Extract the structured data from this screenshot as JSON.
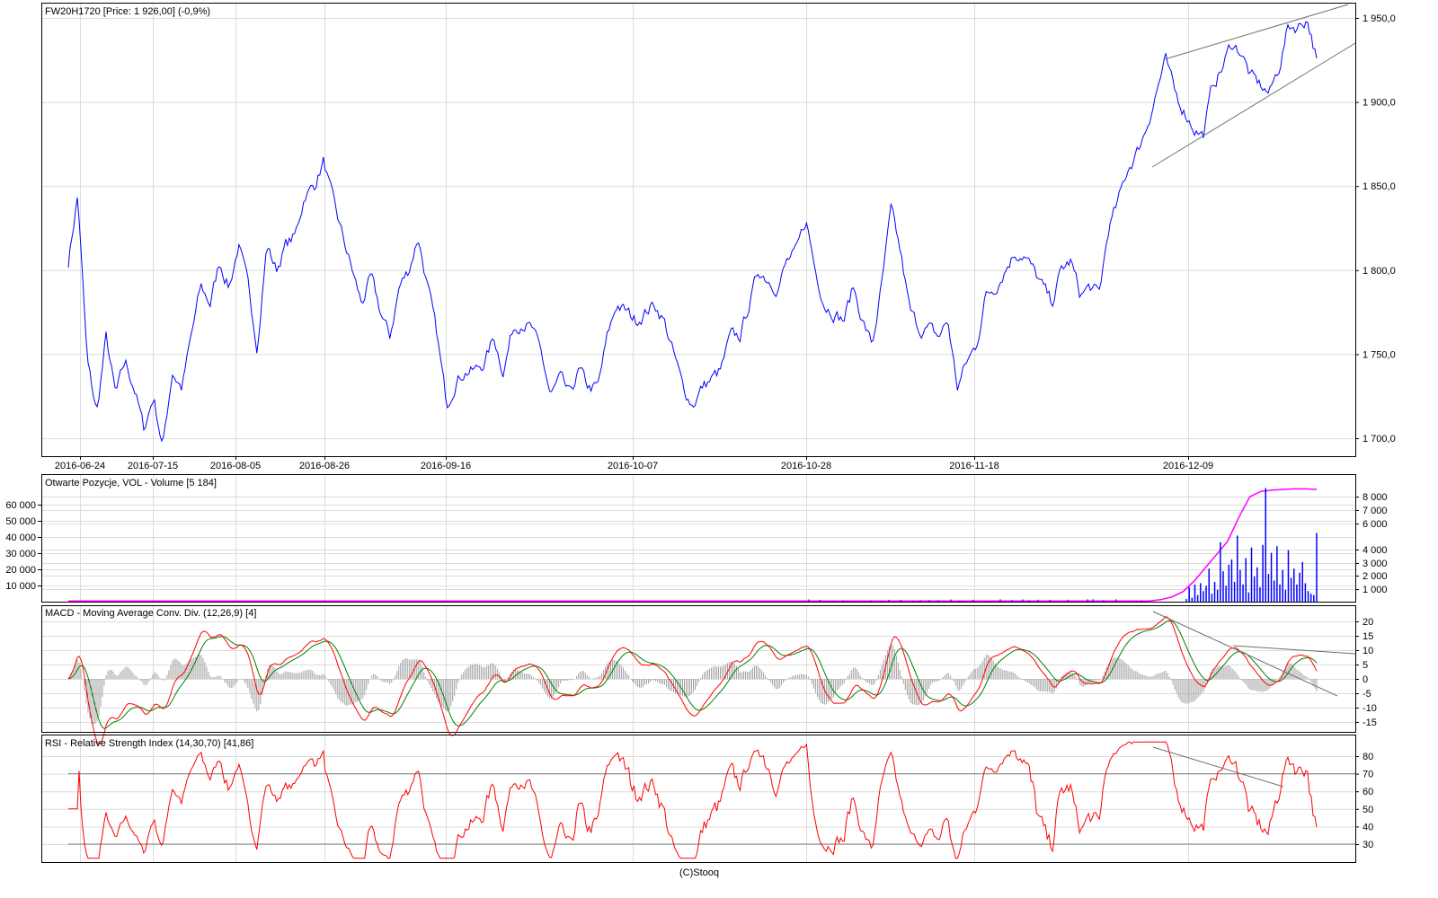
{
  "panels": {
    "price": {
      "title": "FW20H1720 [Price: 1 926,00] (-0,9%)"
    },
    "volume": {
      "title": "Otwarte Pozycje, VOL - Volume [5 184]"
    },
    "macd": {
      "title": "MACD - Moving Average Conv. Div. (12,26,9) [4]"
    },
    "rsi": {
      "title": "RSI - Relative Strength Index (14,30,70) [41,86]"
    }
  },
  "footer": "(C)Stooq",
  "colors": {
    "price": "#0000ff",
    "open_interest": "#ff00ff",
    "volume": "#0000ff",
    "macd": "#ff0000",
    "signal": "#008000",
    "histogram": "#a0a0a0",
    "rsi": "#ff0000",
    "trendline": "#707070"
  },
  "chart_data": [
    {
      "type": "line",
      "name": "price",
      "xlabel": "",
      "ylabel": "",
      "x_ticks": [
        "2016-06-24",
        "2016-07-15",
        "2016-08-05",
        "2016-08-26",
        "2016-09-16",
        "2016-10-07",
        "2016-10-28",
        "2016-11-18",
        "2016-12-09"
      ],
      "y_ticks": [
        "1 950,0",
        "1 900,0",
        "1 850,0",
        "1 800,0",
        "1 750,0",
        "1 700,0"
      ],
      "ylim": [
        1690,
        1960
      ],
      "values": [
        1805,
        1845,
        1745,
        1715,
        1760,
        1725,
        1745,
        1730,
        1705,
        1725,
        1695,
        1740,
        1730,
        1760,
        1790,
        1780,
        1805,
        1790,
        1815,
        1790,
        1755,
        1815,
        1800,
        1815,
        1820,
        1845,
        1850,
        1865,
        1840,
        1820,
        1800,
        1780,
        1795,
        1775,
        1760,
        1790,
        1800,
        1820,
        1790,
        1760,
        1720,
        1735,
        1740,
        1740,
        1745,
        1760,
        1740,
        1765,
        1770,
        1765,
        1750,
        1725,
        1735,
        1725,
        1740,
        1730,
        1730,
        1760,
        1780,
        1775,
        1770,
        1775,
        1780,
        1770,
        1750,
        1730,
        1720,
        1730,
        1735,
        1740,
        1760,
        1760,
        1780,
        1800,
        1795,
        1790,
        1805,
        1810,
        1830,
        1800,
        1780,
        1775,
        1770,
        1790,
        1770,
        1755,
        1790,
        1835,
        1810,
        1775,
        1765,
        1765,
        1760,
        1770,
        1730,
        1745,
        1755,
        1785,
        1790,
        1800,
        1810,
        1810,
        1800,
        1790,
        1780,
        1800,
        1805,
        1785,
        1790,
        1785,
        1825,
        1840,
        1860,
        1870,
        1885,
        1905,
        1925,
        1905,
        1895,
        1885,
        1880,
        1910,
        1920,
        1935,
        1930,
        1915,
        1910,
        1905,
        1920,
        1945,
        1945,
        1950,
        1926
      ]
    },
    {
      "type": "bar",
      "name": "volume",
      "left_y_ticks": [
        "60 000",
        "50 000",
        "40 000",
        "30 000",
        "20 000",
        "10 000"
      ],
      "right_y_ticks": [
        "8 000",
        "7 000",
        "6 000",
        "4 000",
        "3 000",
        "2 000",
        "1 000"
      ],
      "open_interest": [
        0,
        0,
        0,
        0,
        0,
        0,
        0,
        0,
        0,
        0,
        0,
        0,
        0,
        100,
        300,
        700,
        1500,
        2500,
        3500,
        4500,
        6300,
        7900,
        8300,
        8400,
        8450,
        8500,
        8500,
        8450
      ],
      "volume_recent": [
        200,
        1100,
        300,
        1300,
        500,
        1400,
        800,
        1200,
        2500,
        600,
        1500,
        900,
        4500,
        2300,
        1200,
        2800,
        3200,
        1500,
        5000,
        2400,
        1300,
        3300,
        700,
        4100,
        1900,
        2600,
        1100,
        4300,
        8600,
        2100,
        3700,
        1600,
        4200,
        1300,
        2400,
        900,
        3900,
        1800,
        2500,
        1300,
        2200,
        3000,
        1400,
        800,
        600,
        500,
        5200
      ]
    },
    {
      "type": "line",
      "name": "macd",
      "series": [
        "MACD (12,26)",
        "Signal (9)",
        "Histogram"
      ],
      "y_ticks": [
        "20",
        "15",
        "10",
        "5",
        "0",
        "-5",
        "-10",
        "-15"
      ],
      "ylim": [
        -18,
        22
      ]
    },
    {
      "type": "line",
      "name": "rsi",
      "series": [
        "RSI (14)"
      ],
      "levels": [
        30,
        70
      ],
      "y_ticks": [
        "80",
        "70",
        "60",
        "50",
        "40",
        "30"
      ],
      "ylim": [
        20,
        90
      ]
    }
  ]
}
